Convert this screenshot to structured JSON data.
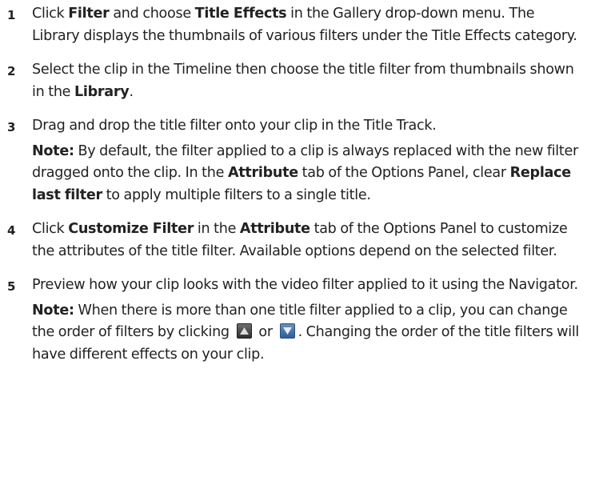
{
  "steps": [
    {
      "number": "1",
      "parts": [
        {
          "text": "Click ",
          "bold": false
        },
        {
          "text": "Filter",
          "bold": true
        },
        {
          "text": " and choose ",
          "bold": false
        },
        {
          "text": "Title Effects",
          "bold": true
        },
        {
          "text": " in the Gallery drop-down menu. The Library displays the thumbnails of various filters under the Title Effects category.",
          "bold": false
        }
      ]
    },
    {
      "number": "2",
      "parts": [
        {
          "text": "Select the clip in the Timeline then choose the title filter from thumbnails shown in the ",
          "bold": false
        },
        {
          "text": "Library",
          "bold": true
        },
        {
          "text": ".",
          "bold": false
        }
      ]
    },
    {
      "number": "3",
      "parts": [
        {
          "text": "Drag and drop the title filter onto your clip in the Title Track.",
          "bold": false
        }
      ],
      "note": {
        "label": "Note:",
        "parts": [
          {
            "text": "  By default, the filter applied to a clip is always replaced with the new filter dragged onto the clip. In the ",
            "bold": false
          },
          {
            "text": "Attribute",
            "bold": true
          },
          {
            "text": " tab of the Options Panel, clear ",
            "bold": false
          },
          {
            "text": "Replace last filter",
            "bold": true
          },
          {
            "text": " to apply multiple filters to a single title.",
            "bold": false
          }
        ]
      }
    },
    {
      "number": "4",
      "parts": [
        {
          "text": "Click ",
          "bold": false
        },
        {
          "text": "Customize Filter",
          "bold": true
        },
        {
          "text": " in the ",
          "bold": false
        },
        {
          "text": "Attribute",
          "bold": true
        },
        {
          "text": " tab of the Options Panel to customize the attributes of the title filter. Available options depend on the selected filter.",
          "bold": false
        }
      ]
    },
    {
      "number": "5",
      "parts": [
        {
          "text": "Preview how your clip looks with the video filter applied to it using the Navigator.",
          "bold": false
        }
      ],
      "note": {
        "label": "Note:",
        "parts": [
          {
            "text": "  When there is more than one title filter applied to a clip, you can change the order of filters by clicking ",
            "bold": false
          },
          {
            "icon": "move-up-icon"
          },
          {
            "text": " or ",
            "bold": false
          },
          {
            "icon": "move-down-icon"
          },
          {
            "text": ". Changing the order of the title filters will have different effects on your clip.",
            "bold": false
          }
        ]
      }
    }
  ]
}
